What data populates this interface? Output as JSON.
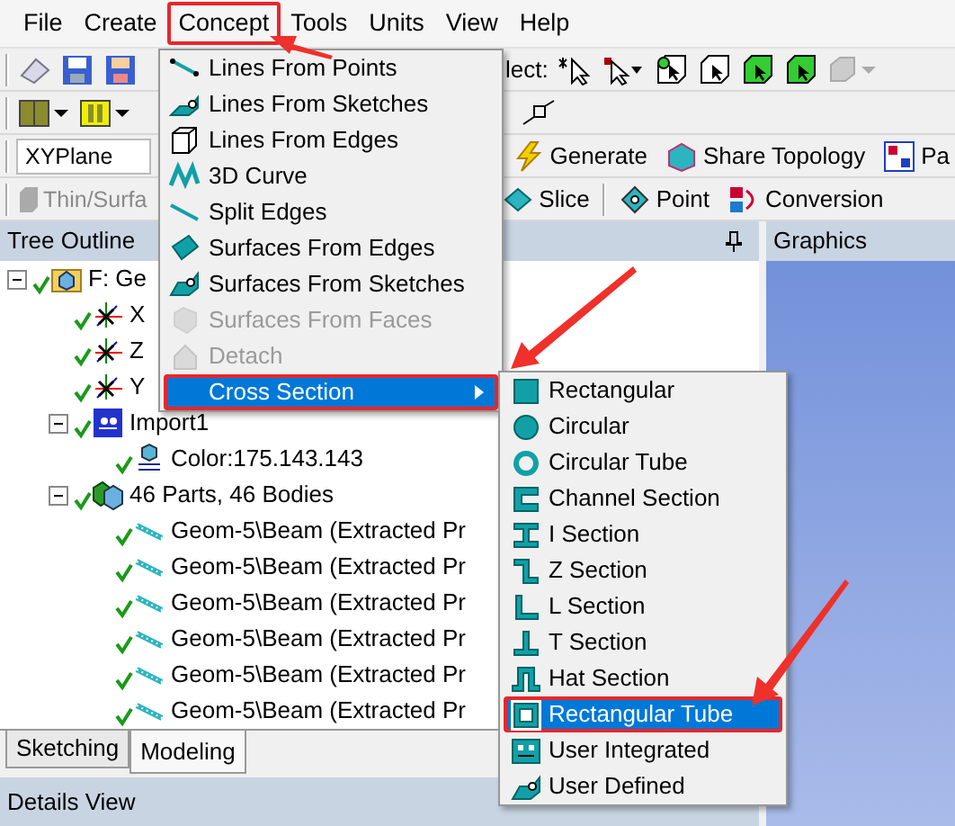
{
  "menubar": [
    {
      "label": "File",
      "highlighted": false
    },
    {
      "label": "Create",
      "highlighted": false
    },
    {
      "label": "Concept",
      "highlighted": true
    },
    {
      "label": "Tools",
      "highlighted": false
    },
    {
      "label": "Units",
      "highlighted": false
    },
    {
      "label": "View",
      "highlighted": false
    },
    {
      "label": "Help",
      "highlighted": false
    }
  ],
  "toolbar": {
    "select_label": "lect:",
    "plane_field": "XYPlane",
    "buttons": [
      "Generate",
      "Share Topology",
      "Pa"
    ],
    "disabled_button": "Thin/Surfa",
    "buttons_row4": [
      "Slice",
      "Point",
      "Conversion"
    ]
  },
  "tree_outline": {
    "title": "Tree Outline",
    "nodes": [
      {
        "label": "F: Ge",
        "kind": "geometry",
        "valid": true,
        "expanded": true,
        "children": [
          {
            "label": "X",
            "kind": "plane",
            "valid": true
          },
          {
            "label": "Z",
            "kind": "plane",
            "valid": true
          },
          {
            "label": "Y",
            "kind": "plane",
            "valid": true
          },
          {
            "label": "Import1",
            "kind": "import",
            "valid": true,
            "expanded": true,
            "children": [
              {
                "label": "Color:175.143.143",
                "kind": "color",
                "valid": true
              }
            ]
          },
          {
            "label": "46 Parts, 46 Bodies",
            "kind": "parts",
            "valid": true,
            "expanded": true,
            "children": [
              {
                "label": "Geom-5\\Beam (Extracted Pr",
                "kind": "beam",
                "valid": true
              },
              {
                "label": "Geom-5\\Beam (Extracted Pr",
                "kind": "beam",
                "valid": true
              },
              {
                "label": "Geom-5\\Beam (Extracted Pr",
                "kind": "beam",
                "valid": true
              },
              {
                "label": "Geom-5\\Beam (Extracted Pr",
                "kind": "beam",
                "valid": true
              },
              {
                "label": "Geom-5\\Beam (Extracted Pr",
                "kind": "beam",
                "valid": true
              },
              {
                "label": "Geom-5\\Beam (Extracted Pr",
                "kind": "beam",
                "valid": true
              }
            ]
          }
        ]
      }
    ]
  },
  "graphics": {
    "title": "Graphics"
  },
  "bottom_tabs": [
    {
      "label": "Sketching",
      "selected": false
    },
    {
      "label": "Modeling",
      "selected": true
    }
  ],
  "details_view": {
    "title": "Details View"
  },
  "concept_menu": [
    {
      "label": "Lines From Points",
      "kind": "command",
      "disabled": false,
      "selected": false,
      "highlighted": false
    },
    {
      "label": "Lines From Sketches",
      "kind": "command",
      "disabled": false,
      "selected": false,
      "highlighted": false
    },
    {
      "label": "Lines From Edges",
      "kind": "command",
      "disabled": false,
      "selected": false,
      "highlighted": false
    },
    {
      "label": "3D Curve",
      "kind": "command",
      "disabled": false,
      "selected": false,
      "highlighted": false
    },
    {
      "label": "Split Edges",
      "kind": "command",
      "disabled": false,
      "selected": false,
      "highlighted": false
    },
    {
      "label": "Surfaces From Edges",
      "kind": "command",
      "disabled": false,
      "selected": false,
      "highlighted": false
    },
    {
      "label": "Surfaces From Sketches",
      "kind": "command",
      "disabled": false,
      "selected": false,
      "highlighted": false
    },
    {
      "label": "Surfaces From Faces",
      "kind": "command",
      "disabled": true,
      "selected": false,
      "highlighted": false
    },
    {
      "label": "Detach",
      "kind": "command",
      "disabled": true,
      "selected": false,
      "highlighted": false
    },
    {
      "label": "Cross Section",
      "kind": "submenu",
      "disabled": false,
      "selected": true,
      "highlighted": true
    }
  ],
  "cross_section_menu": [
    {
      "label": "Rectangular",
      "selected": false,
      "highlighted": false
    },
    {
      "label": "Circular",
      "selected": false,
      "highlighted": false
    },
    {
      "label": "Circular Tube",
      "selected": false,
      "highlighted": false
    },
    {
      "label": "Channel Section",
      "selected": false,
      "highlighted": false
    },
    {
      "label": "I Section",
      "selected": false,
      "highlighted": false
    },
    {
      "label": "Z Section",
      "selected": false,
      "highlighted": false
    },
    {
      "label": "L Section",
      "selected": false,
      "highlighted": false
    },
    {
      "label": "T Section",
      "selected": false,
      "highlighted": false
    },
    {
      "label": "Hat Section",
      "selected": false,
      "highlighted": false
    },
    {
      "label": "Rectangular Tube",
      "selected": true,
      "highlighted": true
    },
    {
      "label": "User Integrated",
      "selected": false,
      "highlighted": false
    },
    {
      "label": "User Defined",
      "selected": false,
      "highlighted": false
    }
  ]
}
